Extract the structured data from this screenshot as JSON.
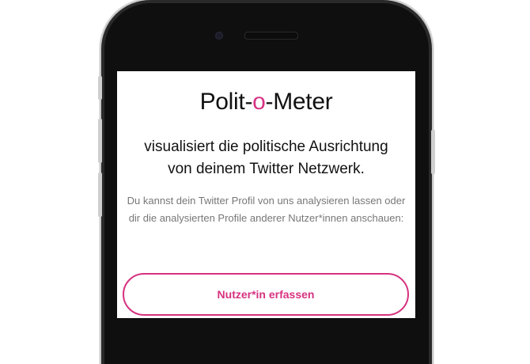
{
  "app": {
    "title_prefix": "Polit-",
    "title_accent": "o",
    "title_suffix": "-Meter"
  },
  "intro": {
    "line1": "visualisiert die politische Ausrichtung",
    "line2": "von deinem Twitter Netzwerk."
  },
  "description": {
    "line1": "Du kannst dein Twitter Profil von uns analysieren lassen oder",
    "line2": "dir die analysierten Profile anderer Nutzer*innen anschauen:"
  },
  "cta": {
    "label": "Nutzer*in erfassen"
  },
  "colors": {
    "accent": "#d6327f",
    "text": "#111111",
    "muted": "#777777",
    "phone_frame": "#2a2a2a"
  }
}
